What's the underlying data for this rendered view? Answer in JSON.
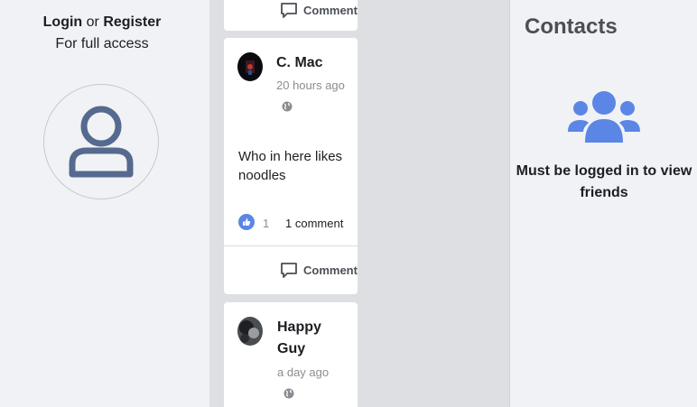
{
  "auth": {
    "login_label": "Login",
    "or_label": "or",
    "register_label": "Register",
    "subtitle": "For full access"
  },
  "feed": {
    "comment_label": "Comment",
    "posts": [
      {
        "author": "C. Mac",
        "time": "20 hours ago",
        "text": "Who in here likes noodles",
        "like_count": "1",
        "comment_count": "1 comment"
      },
      {
        "author": "Happy Guy",
        "time": "a day ago"
      }
    ]
  },
  "contacts": {
    "title": "Contacts",
    "message": "Must be logged in to view friends"
  },
  "colors": {
    "accent": "#5b86e5",
    "panel_bg": "#f0f2f5",
    "feed_bg": "#dddfe2"
  },
  "icons": {
    "profile": "user-outline-icon",
    "comment": "comment-icon",
    "privacy": "globe-icon",
    "like": "thumbs-up-icon",
    "friends": "users-group-icon"
  }
}
